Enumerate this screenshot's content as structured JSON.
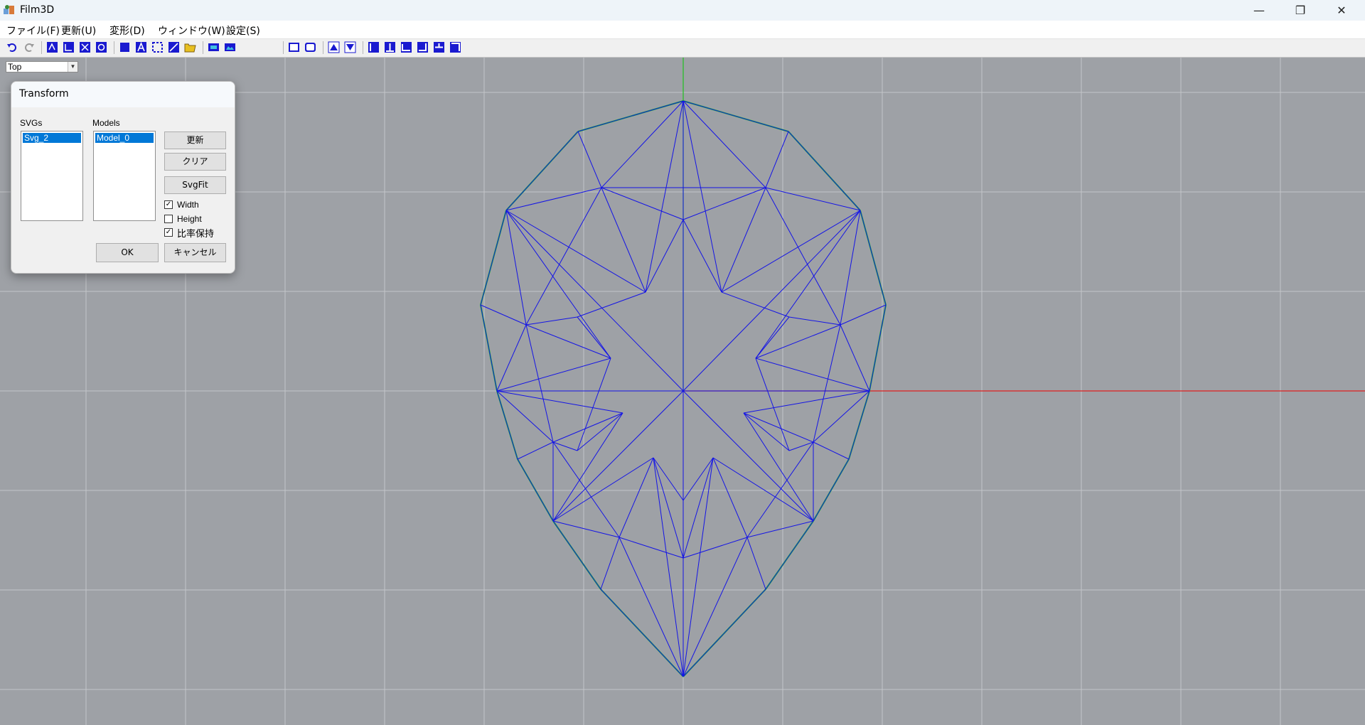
{
  "window": {
    "title": "Film3D",
    "minimize_glyph": "—",
    "restore_glyph": "❐",
    "close_glyph": "✕"
  },
  "menu": [
    {
      "label": "ファイル(F)"
    },
    {
      "label": "更新(U)"
    },
    {
      "label": "変形(D)"
    },
    {
      "label": "ウィンドウ(W)"
    },
    {
      "label": "設定(S)"
    }
  ],
  "toolbar": {
    "icons": [
      "undo-icon",
      "redo-icon",
      "model-icon-1",
      "model-icon-2",
      "model-icon-3",
      "model-icon-4",
      "rect-icon",
      "text-icon",
      "select-icon",
      "line-icon",
      "folder-icon",
      "layer-icon-1",
      "layer-icon-2",
      "view-icon-1",
      "view-icon-2",
      "view-icon-3",
      "view-icon-4",
      "align-icon-1",
      "align-icon-2",
      "align-icon-3",
      "align-icon-4",
      "align-icon-5",
      "align-icon-6"
    ],
    "accent": "#1a1ad0"
  },
  "view": {
    "selected": "Top"
  },
  "dialog": {
    "title": "Transform",
    "svgs_label": "SVGs",
    "models_label": "Models",
    "svgs_items": [
      "Svg_2"
    ],
    "models_items": [
      "Model_0"
    ],
    "update_button": "更新",
    "clear_button": "クリア",
    "svgfit_button": "SvgFit",
    "ok_button": "OK",
    "cancel_button": "キャンセル",
    "checks": [
      {
        "label": "Width",
        "checked": true
      },
      {
        "label": "Height",
        "checked": false
      },
      {
        "label": "比率保持",
        "checked": true
      }
    ]
  },
  "colors": {
    "mesh": "#1414e6",
    "x_axis": "#e02020",
    "y_axis": "#20c020",
    "grid": "#c3c5c9",
    "background": "#9ea1a6"
  }
}
